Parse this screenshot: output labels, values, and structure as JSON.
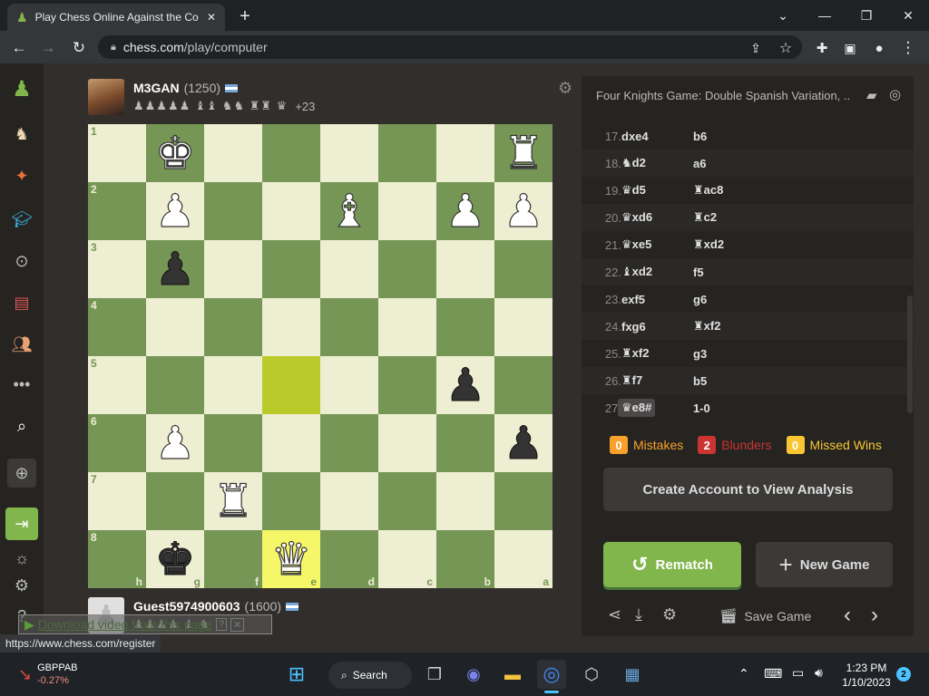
{
  "browser": {
    "tab_title": "Play Chess Online Against the Co",
    "url_host": "chess.com",
    "url_path": "/play/computer"
  },
  "opponent": {
    "name": "M3GAN",
    "rating": "(1250)",
    "captured": "♟♟♟♟♟ ♝♝ ♞♞ ♜♜ ♛",
    "material": "+23"
  },
  "player": {
    "name": "Guest5974900603",
    "rating": "(1600)",
    "captured": "♟♟♟♟ ♝ ♞"
  },
  "board": {
    "ranks": [
      "1",
      "2",
      "3",
      "4",
      "5",
      "6",
      "7",
      "8"
    ],
    "files": [
      "h",
      "g",
      "f",
      "e",
      "d",
      "c",
      "b",
      "a"
    ],
    "rows": [
      [
        " ",
        "♚",
        " ",
        " ",
        " ",
        " ",
        " ",
        "♜"
      ],
      [
        " ",
        "♟",
        " ",
        " ",
        "♝",
        " ",
        "♟",
        "♟"
      ],
      [
        " ",
        "p",
        " ",
        " ",
        " ",
        " ",
        " ",
        " "
      ],
      [
        " ",
        " ",
        " ",
        " ",
        " ",
        " ",
        " ",
        " "
      ],
      [
        " ",
        " ",
        " ",
        " ",
        " ",
        " ",
        "p",
        " "
      ],
      [
        " ",
        "♟",
        " ",
        " ",
        " ",
        " ",
        " ",
        "p"
      ],
      [
        " ",
        " ",
        "♜",
        " ",
        " ",
        " ",
        " ",
        " "
      ],
      [
        " ",
        "k",
        " ",
        "♛",
        " ",
        " ",
        " ",
        " "
      ]
    ],
    "colors": [
      [
        "w",
        "w",
        "",
        "",
        "w",
        "",
        "",
        "w"
      ],
      [
        "",
        "w",
        "",
        "",
        "w",
        "",
        "w",
        "w"
      ],
      [
        "",
        "b",
        "",
        "",
        "",
        "",
        "",
        ""
      ],
      [
        "",
        "",
        "",
        "",
        "",
        "",
        "",
        ""
      ],
      [
        "",
        "",
        "",
        "",
        "",
        "",
        "b",
        ""
      ],
      [
        "",
        "w",
        "",
        "",
        "",
        "",
        "",
        "b"
      ],
      [
        "",
        "",
        "w",
        "",
        "",
        "",
        "",
        ""
      ],
      [
        "",
        "b",
        "",
        "w",
        "",
        "",
        "",
        ""
      ]
    ]
  },
  "analysis": {
    "opening": "Four Knights Game: Double Spanish Variation, ...",
    "moves": [
      {
        "num": "17.",
        "white": "dxe4",
        "black": "b6"
      },
      {
        "num": "18.",
        "white": "♞d2",
        "black": "a6"
      },
      {
        "num": "19.",
        "white": "♛d5",
        "black": "♜ac8"
      },
      {
        "num": "20.",
        "white": "♛xd6",
        "black": "♜c2"
      },
      {
        "num": "21.",
        "white": "♛xe5",
        "black": "♜xd2"
      },
      {
        "num": "22.",
        "white": "♝xd2",
        "black": "f5"
      },
      {
        "num": "23.",
        "white": "exf5",
        "black": "g6"
      },
      {
        "num": "24.",
        "white": "fxg6",
        "black": "♜xf2"
      },
      {
        "num": "25.",
        "white": "♜xf2",
        "black": "g3"
      },
      {
        "num": "26.",
        "white": "♜f7",
        "black": "b5"
      },
      {
        "num": "27.",
        "white": "♛e8#",
        "black": "1-0"
      }
    ],
    "mistakes_count": "0",
    "mistakes_label": "Mistakes",
    "blunders_count": "2",
    "blunders_label": "Blunders",
    "missed_count": "0",
    "missed_label": "Missed Wins",
    "create_account": "Create Account to View Analysis",
    "rematch": "Rematch",
    "new_game": "New Game",
    "save_game": "Save Game"
  },
  "overlay": {
    "download_video": "Download video from this page",
    "status_url": "https://www.chess.com/register"
  },
  "taskbar": {
    "ticker_symbol": "GBPPAB",
    "ticker_change": "-0.27%",
    "search": "Search",
    "time": "1:23 PM",
    "date": "1/10/2023",
    "notifications": "2"
  },
  "colors": {
    "green_button": "#81b64c",
    "mistake": "#f7a02b",
    "blunder": "#ca3431",
    "missed": "#f7c631"
  }
}
